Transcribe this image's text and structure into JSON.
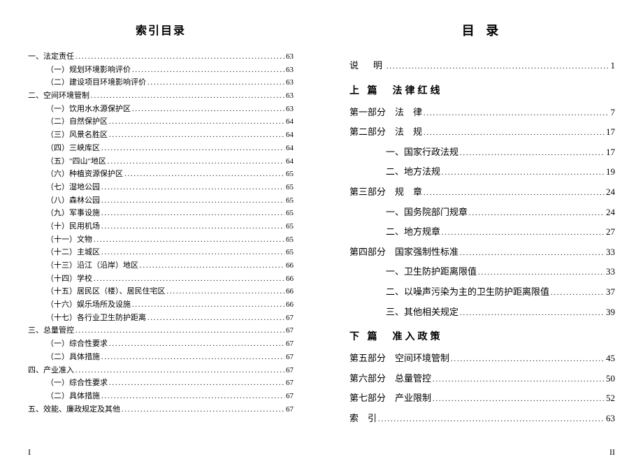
{
  "left": {
    "title": "索引目录",
    "pageNumber": "I",
    "entries": [
      {
        "label": "一、法定责任",
        "page": "63",
        "indent": 0
      },
      {
        "label": "（一）规划环境影响评价",
        "page": "63",
        "indent": 1
      },
      {
        "label": "（二）建设项目环境影响评价",
        "page": "63",
        "indent": 1
      },
      {
        "label": "二、空间环境管制",
        "page": "63",
        "indent": 0
      },
      {
        "label": "（一）饮用水水源保护区",
        "page": "63",
        "indent": 1
      },
      {
        "label": "（二）自然保护区",
        "page": "64",
        "indent": 1
      },
      {
        "label": "（三）风景名胜区",
        "page": "64",
        "indent": 1
      },
      {
        "label": "（四）三峡库区",
        "page": "64",
        "indent": 1
      },
      {
        "label": "（五）\"四山\"地区",
        "page": "64",
        "indent": 1
      },
      {
        "label": "（六）种植资源保护区",
        "page": "65",
        "indent": 1
      },
      {
        "label": "（七）湿地公园",
        "page": "65",
        "indent": 1
      },
      {
        "label": "（八）森林公园",
        "page": "65",
        "indent": 1
      },
      {
        "label": "（九）军事设施",
        "page": "65",
        "indent": 1
      },
      {
        "label": "（十）民用机场",
        "page": "65",
        "indent": 1
      },
      {
        "label": "（十一）文物",
        "page": "65",
        "indent": 1
      },
      {
        "label": "（十二）主城区",
        "page": "65",
        "indent": 1
      },
      {
        "label": "（十三）沿江（沿岸）地区",
        "page": "66",
        "indent": 1
      },
      {
        "label": "（十四）学校",
        "page": "66",
        "indent": 1
      },
      {
        "label": "（十五）居民区（楼）、居民住宅区",
        "page": "66",
        "indent": 1
      },
      {
        "label": "（十六）娱乐场所及设施",
        "page": "66",
        "indent": 1
      },
      {
        "label": "（十七）各行业卫生防护距离",
        "page": "67",
        "indent": 1
      },
      {
        "label": "三、总量管控",
        "page": "67",
        "indent": 0
      },
      {
        "label": "（一）综合性要求",
        "page": "67",
        "indent": 1
      },
      {
        "label": "（二）具体措施",
        "page": "67",
        "indent": 1
      },
      {
        "label": "四、产业准入",
        "page": "67",
        "indent": 0
      },
      {
        "label": "（一）综合性要求",
        "page": "67",
        "indent": 1
      },
      {
        "label": "（二）具体措施",
        "page": "67",
        "indent": 1
      },
      {
        "label": "五、效能、廉政规定及其他",
        "page": "67",
        "indent": 0
      }
    ]
  },
  "right": {
    "title": "目 录",
    "pageNumber": "II",
    "sections": [
      {
        "type": "line",
        "label": "说　明",
        "page": "1",
        "indent": 0,
        "spaced": true
      },
      {
        "type": "heading",
        "label": "上 篇　法律红线"
      },
      {
        "type": "line",
        "label": "第一部分　法　律",
        "page": "7",
        "indent": 0
      },
      {
        "type": "line",
        "label": "第二部分　法　规",
        "page": "17",
        "indent": 0
      },
      {
        "type": "line",
        "label": "一、国家行政法规",
        "page": "17",
        "indent": 2
      },
      {
        "type": "line",
        "label": "二、地方法规",
        "page": "19",
        "indent": 2
      },
      {
        "type": "line",
        "label": "第三部分　规　章",
        "page": "24",
        "indent": 0
      },
      {
        "type": "line",
        "label": "一、国务院部门规章",
        "page": "24",
        "indent": 2
      },
      {
        "type": "line",
        "label": "二、地方规章",
        "page": "27",
        "indent": 2
      },
      {
        "type": "line",
        "label": "第四部分　国家强制性标准",
        "page": "33",
        "indent": 0
      },
      {
        "type": "line",
        "label": "一、卫生防护距离限值",
        "page": "33",
        "indent": 2
      },
      {
        "type": "line",
        "label": "二、以噪声污染为主的卫生防护距离限值",
        "page": "37",
        "indent": 2
      },
      {
        "type": "line",
        "label": "三、其他相关规定",
        "page": "39",
        "indent": 2
      },
      {
        "type": "heading",
        "label": "下 篇　准入政策"
      },
      {
        "type": "line",
        "label": "第五部分　空间环境管制",
        "page": "45",
        "indent": 0
      },
      {
        "type": "line",
        "label": "第六部分　总量管控",
        "page": "50",
        "indent": 0
      },
      {
        "type": "line",
        "label": "第七部分　产业限制",
        "page": "52",
        "indent": 0
      },
      {
        "type": "line",
        "label": "索　引",
        "page": "63",
        "indent": 0
      }
    ]
  }
}
